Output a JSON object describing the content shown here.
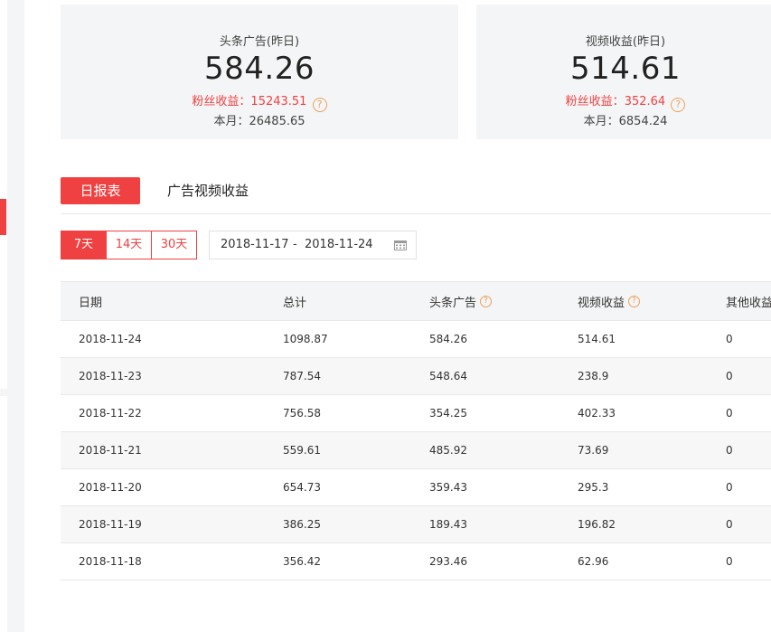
{
  "cards": [
    {
      "title": "头条广告(昨日)",
      "value": "584.26",
      "fans_label": "粉丝收益：",
      "fans_value": "15243.51",
      "month_label": "本月：",
      "month_value": "26485.65"
    },
    {
      "title": "视频收益(昨日)",
      "value": "514.61",
      "fans_label": "粉丝收益：",
      "fans_value": "352.64",
      "month_label": "本月：",
      "month_value": "6854.24"
    }
  ],
  "tabs": {
    "daily": "日报表",
    "ad_video": "广告视频收益"
  },
  "range": [
    "7天",
    "14天",
    "30天"
  ],
  "date_range": {
    "start": "2018-11-17",
    "sep": "-",
    "end": "2018-11-24"
  },
  "table": {
    "headers": [
      "日期",
      "总计",
      "头条广告",
      "视频收益",
      "其他收益"
    ],
    "rows": [
      [
        "2018-11-24",
        "1098.87",
        "584.26",
        "514.61",
        "0"
      ],
      [
        "2018-11-23",
        "787.54",
        "548.64",
        "238.9",
        "0"
      ],
      [
        "2018-11-22",
        "756.58",
        "354.25",
        "402.33",
        "0"
      ],
      [
        "2018-11-21",
        "559.61",
        "485.92",
        "73.69",
        "0"
      ],
      [
        "2018-11-20",
        "654.73",
        "359.43",
        "295.3",
        "0"
      ],
      [
        "2018-11-19",
        "386.25",
        "189.43",
        "196.82",
        "0"
      ],
      [
        "2018-11-18",
        "356.42",
        "293.46",
        "62.96",
        "0"
      ]
    ]
  },
  "colors": {
    "accent": "#f04142",
    "help": "#f0a05a"
  },
  "icons": {
    "help": "question-circle-icon",
    "calendar": "calendar-icon"
  }
}
